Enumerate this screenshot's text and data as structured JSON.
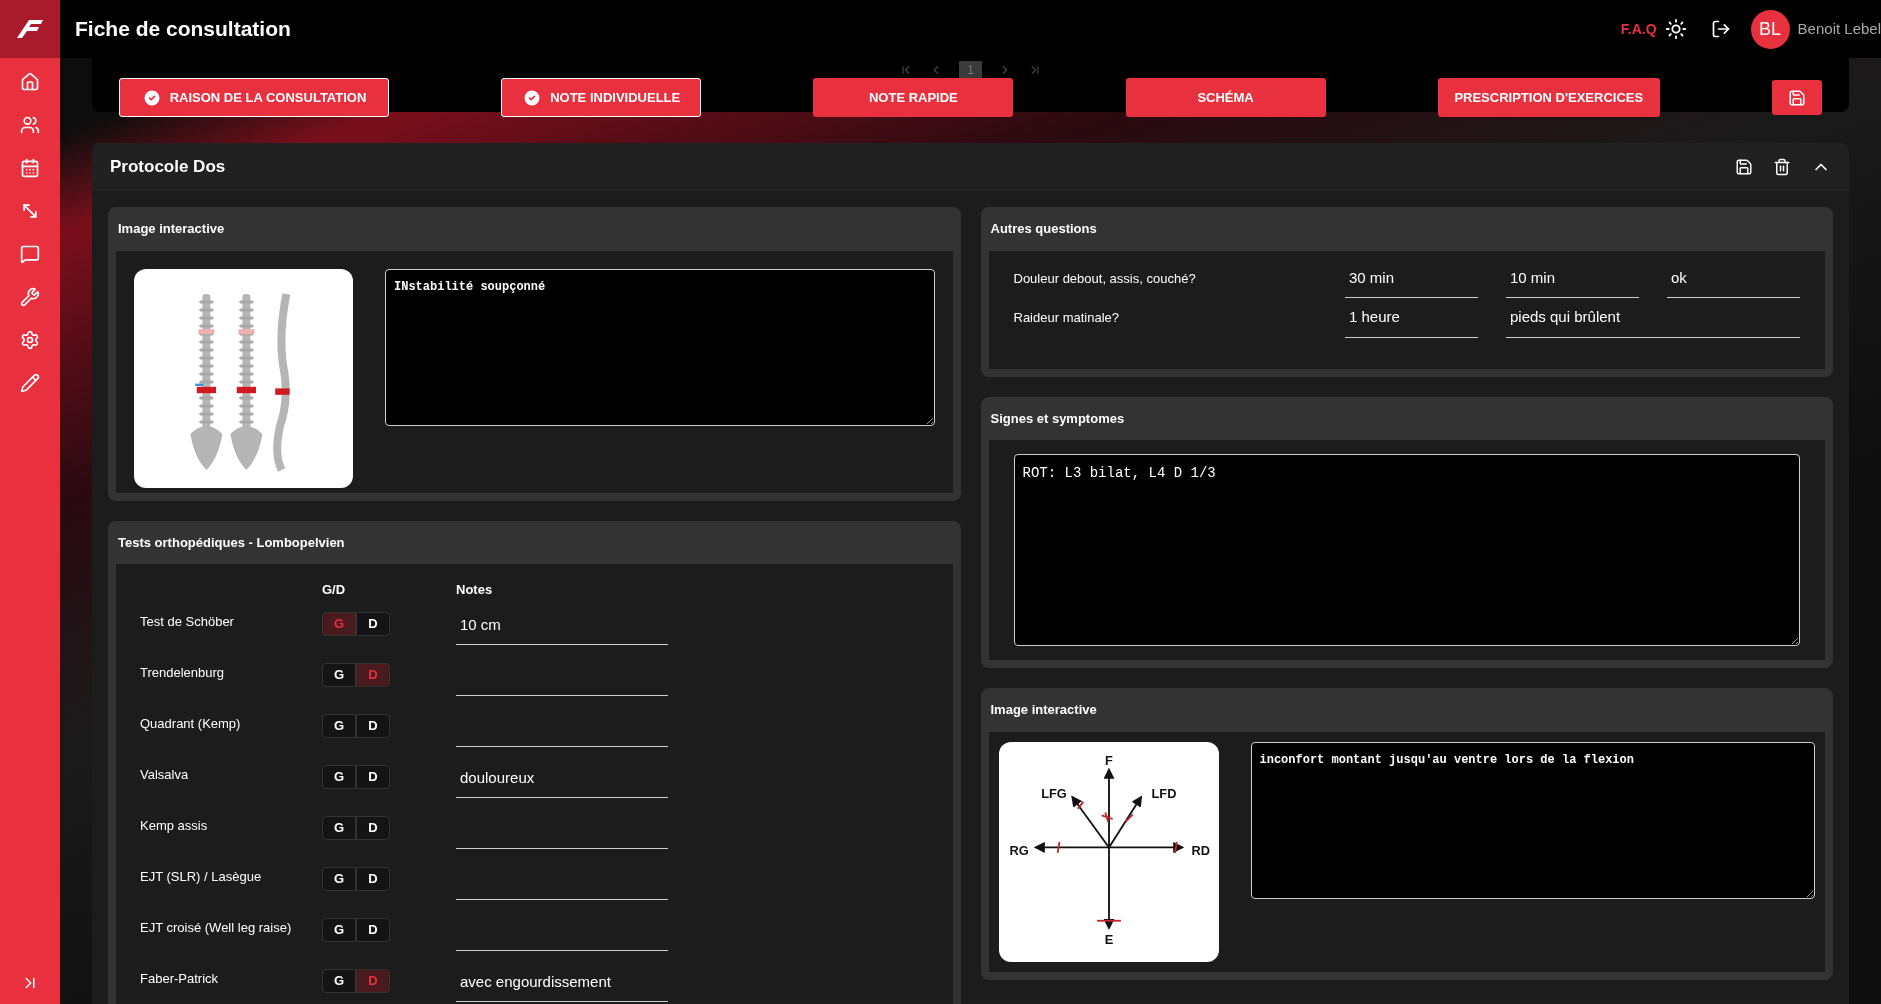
{
  "app": {
    "title": "Fiche de consultation"
  },
  "header": {
    "faq": "F.A.Q",
    "user": {
      "initials": "BL",
      "name": "Benoit Lebel"
    }
  },
  "pagination": {
    "page": "1"
  },
  "tabs": [
    {
      "label": "RAISON DE LA CONSULTATION",
      "completed": true
    },
    {
      "label": "NOTE INDIVIDUELLE",
      "completed": true
    },
    {
      "label": "NOTE RAPIDE",
      "completed": false
    },
    {
      "label": "SCHÉMA",
      "completed": false
    },
    {
      "label": "PRESCRIPTION D'EXERCICES",
      "completed": false
    }
  ],
  "protocol": {
    "title": "Protocole Dos",
    "image_card": {
      "title": "Image interactive",
      "notes": "INstabilité soupçonné"
    },
    "tests": {
      "title": "Tests orthopédiques - Lombopelvien",
      "columns": [
        "G/D",
        "Notes"
      ],
      "rows": [
        {
          "name": "Test de Schöber",
          "toggle": [
            {
              "label": "G",
              "selected": true
            },
            {
              "label": "D",
              "selected": false
            }
          ],
          "note": "10 cm"
        },
        {
          "name": "Trendelenburg",
          "toggle": [
            {
              "label": "G",
              "selected": false
            },
            {
              "label": "D",
              "selected": true
            }
          ]
        },
        {
          "name": "Quadrant (Kemp)",
          "toggle": [
            {
              "label": "G",
              "selected": false
            },
            {
              "label": "D",
              "selected": false
            }
          ]
        },
        {
          "name": "Valsalva",
          "toggle": [
            {
              "label": "G",
              "selected": false
            },
            {
              "label": "D",
              "selected": false
            }
          ],
          "note": "douloureux"
        },
        {
          "name": "Kemp assis",
          "toggle": [
            {
              "label": "G",
              "selected": false
            },
            {
              "label": "D",
              "selected": false
            }
          ]
        },
        {
          "name": "EJT (SLR) / Lasègue",
          "toggle": [
            {
              "label": "G",
              "selected": false
            },
            {
              "label": "D",
              "selected": false
            }
          ]
        },
        {
          "name": "EJT croisé (Well leg raise)",
          "toggle": [
            {
              "label": "G",
              "selected": false
            },
            {
              "label": "D",
              "selected": false
            }
          ]
        },
        {
          "name": "Faber-Patrick",
          "toggle": [
            {
              "label": "G",
              "selected": false
            },
            {
              "label": "D",
              "selected": true
            }
          ],
          "note": "avec engourdissement"
        }
      ]
    },
    "questions": {
      "title": "Autres questions",
      "rows": [
        {
          "question": "Douleur debout, assis, couché?",
          "answers": [
            "30 min",
            "10 min",
            "ok"
          ]
        },
        {
          "question": "Raideur matinale?",
          "answers": [
            "1 heure",
            "pieds qui brûlent"
          ]
        }
      ]
    },
    "signs": {
      "title": "Signes et symptomes",
      "text": "ROT: L3 bilat, L4 D 1/3"
    },
    "movement_card": {
      "title": "Image interactive",
      "diagram_labels": [
        "F",
        "LFG",
        "LFD",
        "RG",
        "RD",
        "E"
      ],
      "notes": "inconfort montant jusqu'au ventre lors de la flexion"
    }
  }
}
